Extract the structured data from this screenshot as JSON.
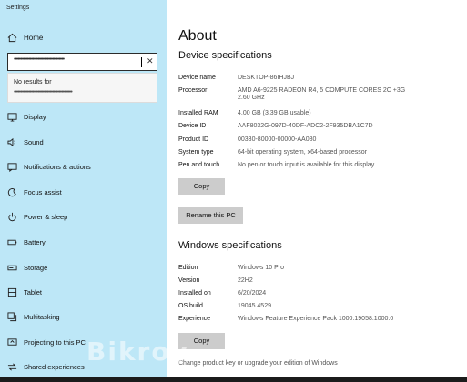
{
  "window": {
    "title": "Settings"
  },
  "sidebar": {
    "home_label": "Home",
    "search": {
      "value": "••••••••••••••••••••••••••••••••••••••",
      "clear_glyph": "✕"
    },
    "dropdown": {
      "no_results": "No results for",
      "query": "••••••••••••••••••••••••••••••••••••••••••••"
    },
    "items": [
      {
        "label": "Display",
        "icon": "display-icon"
      },
      {
        "label": "Sound",
        "icon": "sound-icon"
      },
      {
        "label": "Notifications & actions",
        "icon": "notifications-icon"
      },
      {
        "label": "Focus assist",
        "icon": "focus-assist-icon"
      },
      {
        "label": "Power & sleep",
        "icon": "power-icon"
      },
      {
        "label": "Battery",
        "icon": "battery-icon"
      },
      {
        "label": "Storage",
        "icon": "storage-icon"
      },
      {
        "label": "Tablet",
        "icon": "tablet-icon"
      },
      {
        "label": "Multitasking",
        "icon": "multitasking-icon"
      },
      {
        "label": "Projecting to this PC",
        "icon": "projecting-icon"
      },
      {
        "label": "Shared experiences",
        "icon": "shared-experiences-icon"
      }
    ]
  },
  "main": {
    "title": "About",
    "device_specs": {
      "heading": "Device specifications",
      "rows": [
        {
          "label": "Device name",
          "value": "DESKTOP-86IHJBJ"
        },
        {
          "label": "Processor",
          "value": "AMD A6-9225 RADEON R4, 5 COMPUTE CORES 2C +3G     2.60 GHz"
        },
        {
          "label": "Installed RAM",
          "value": "4.00 GB (3.39 GB usable)"
        },
        {
          "label": "Device ID",
          "value": "AAF8032G-097D-40DF-ADC2-2F935DBA1C7D"
        },
        {
          "label": "Product ID",
          "value": "00330-80000-00000-AA080"
        },
        {
          "label": "System type",
          "value": "64-bit operating system, x64-based processor"
        },
        {
          "label": "Pen and touch",
          "value": "No pen or touch input is available for this display"
        }
      ],
      "copy_label": "Copy",
      "rename_label": "Rename this PC"
    },
    "windows_specs": {
      "heading": "Windows specifications",
      "rows": [
        {
          "label": "Edition",
          "value": "Windows 10 Pro"
        },
        {
          "label": "Version",
          "value": "22H2"
        },
        {
          "label": "Installed on",
          "value": "6/20/2024"
        },
        {
          "label": "OS build",
          "value": "19045.4529"
        },
        {
          "label": "Experience",
          "value": "Windows Feature Experience Pack 1000.19058.1000.0"
        }
      ],
      "copy_label": "Copy"
    },
    "product_key_link": "Change product key or upgrade your edition of Windows"
  },
  "watermark": "Bikroy"
}
